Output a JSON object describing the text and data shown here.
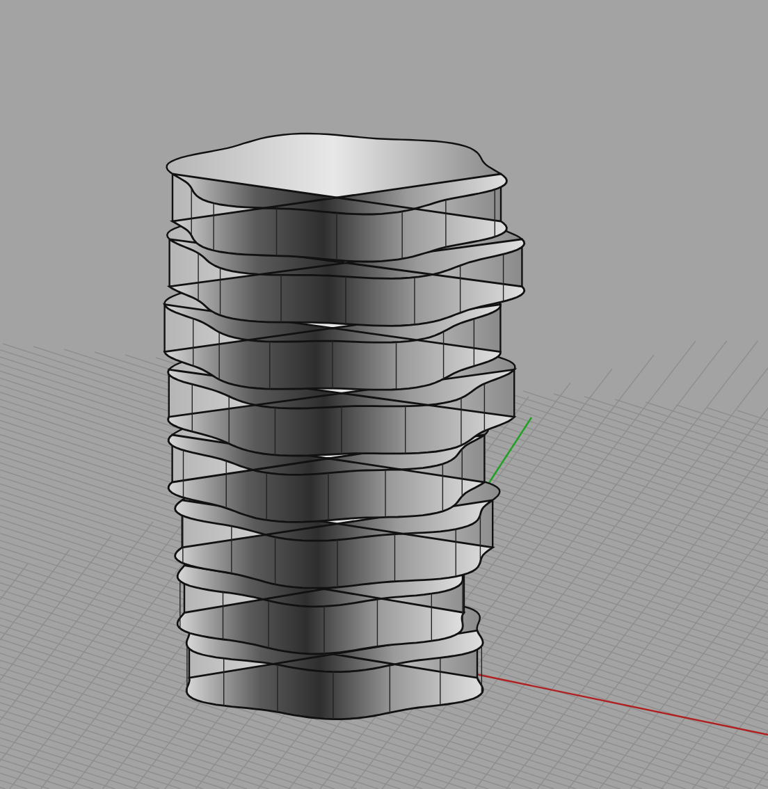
{
  "viewport": {
    "grid": true,
    "axes": true,
    "model": {
      "kind": "twisted-band-tower"
    }
  }
}
